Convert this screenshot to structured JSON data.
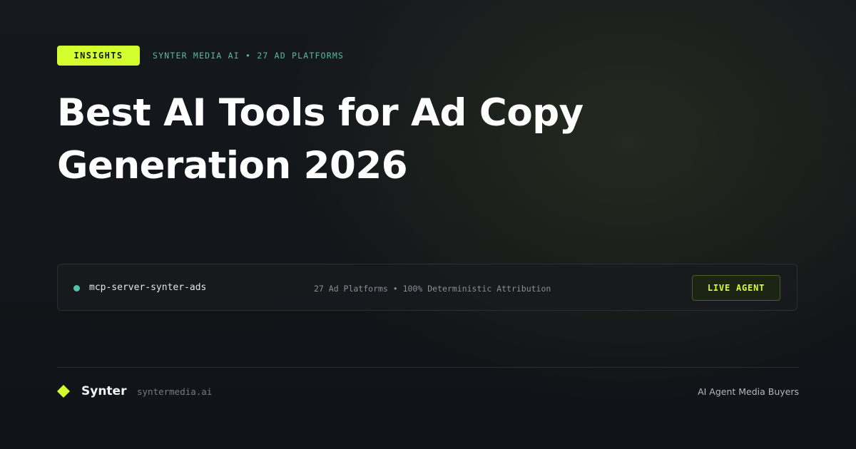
{
  "header": {
    "badge": "INSIGHTS",
    "meta": "SYNTER MEDIA AI • 27 AD PLATFORMS"
  },
  "title": {
    "line1": "Best AI Tools for Ad Copy",
    "line2": "Generation 2026"
  },
  "agent_card": {
    "status_icon": "status-dot",
    "status_color": "#4fc4a8",
    "name": "mcp-server-synter-ads",
    "meta": "27 Ad Platforms • 100% Deterministic Attribution",
    "button_label": "LIVE AGENT"
  },
  "footer": {
    "logo_icon": "diamond-logo",
    "brand": "Synter",
    "domain": "syntermedia.ai",
    "tagline": "AI Agent Media Buyers"
  },
  "colors": {
    "accent": "#d4ff2e",
    "teal": "#59b9a3",
    "background": "#121519"
  }
}
